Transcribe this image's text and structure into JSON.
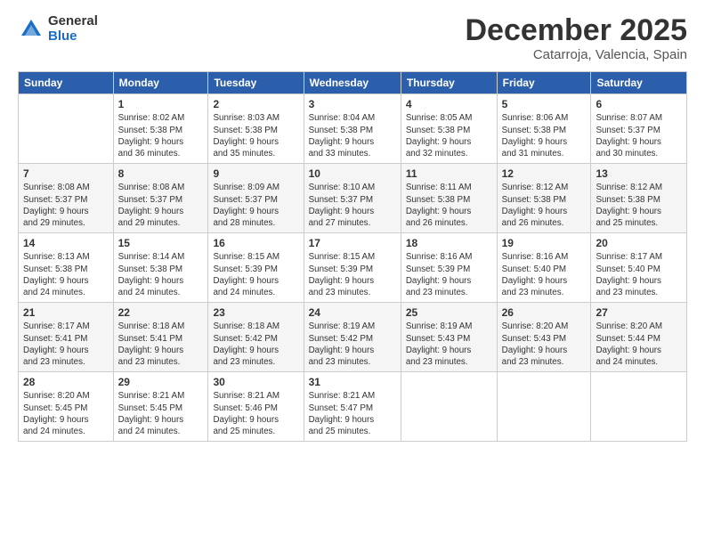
{
  "logo": {
    "general": "General",
    "blue": "Blue"
  },
  "title": "December 2025",
  "location": "Catarroja, Valencia, Spain",
  "weekdays": [
    "Sunday",
    "Monday",
    "Tuesday",
    "Wednesday",
    "Thursday",
    "Friday",
    "Saturday"
  ],
  "weeks": [
    [
      {
        "day": "",
        "info": ""
      },
      {
        "day": "1",
        "info": "Sunrise: 8:02 AM\nSunset: 5:38 PM\nDaylight: 9 hours\nand 36 minutes."
      },
      {
        "day": "2",
        "info": "Sunrise: 8:03 AM\nSunset: 5:38 PM\nDaylight: 9 hours\nand 35 minutes."
      },
      {
        "day": "3",
        "info": "Sunrise: 8:04 AM\nSunset: 5:38 PM\nDaylight: 9 hours\nand 33 minutes."
      },
      {
        "day": "4",
        "info": "Sunrise: 8:05 AM\nSunset: 5:38 PM\nDaylight: 9 hours\nand 32 minutes."
      },
      {
        "day": "5",
        "info": "Sunrise: 8:06 AM\nSunset: 5:38 PM\nDaylight: 9 hours\nand 31 minutes."
      },
      {
        "day": "6",
        "info": "Sunrise: 8:07 AM\nSunset: 5:37 PM\nDaylight: 9 hours\nand 30 minutes."
      }
    ],
    [
      {
        "day": "7",
        "info": "Sunrise: 8:08 AM\nSunset: 5:37 PM\nDaylight: 9 hours\nand 29 minutes."
      },
      {
        "day": "8",
        "info": "Sunrise: 8:08 AM\nSunset: 5:37 PM\nDaylight: 9 hours\nand 29 minutes."
      },
      {
        "day": "9",
        "info": "Sunrise: 8:09 AM\nSunset: 5:37 PM\nDaylight: 9 hours\nand 28 minutes."
      },
      {
        "day": "10",
        "info": "Sunrise: 8:10 AM\nSunset: 5:37 PM\nDaylight: 9 hours\nand 27 minutes."
      },
      {
        "day": "11",
        "info": "Sunrise: 8:11 AM\nSunset: 5:38 PM\nDaylight: 9 hours\nand 26 minutes."
      },
      {
        "day": "12",
        "info": "Sunrise: 8:12 AM\nSunset: 5:38 PM\nDaylight: 9 hours\nand 26 minutes."
      },
      {
        "day": "13",
        "info": "Sunrise: 8:12 AM\nSunset: 5:38 PM\nDaylight: 9 hours\nand 25 minutes."
      }
    ],
    [
      {
        "day": "14",
        "info": "Sunrise: 8:13 AM\nSunset: 5:38 PM\nDaylight: 9 hours\nand 24 minutes."
      },
      {
        "day": "15",
        "info": "Sunrise: 8:14 AM\nSunset: 5:38 PM\nDaylight: 9 hours\nand 24 minutes."
      },
      {
        "day": "16",
        "info": "Sunrise: 8:15 AM\nSunset: 5:39 PM\nDaylight: 9 hours\nand 24 minutes."
      },
      {
        "day": "17",
        "info": "Sunrise: 8:15 AM\nSunset: 5:39 PM\nDaylight: 9 hours\nand 23 minutes."
      },
      {
        "day": "18",
        "info": "Sunrise: 8:16 AM\nSunset: 5:39 PM\nDaylight: 9 hours\nand 23 minutes."
      },
      {
        "day": "19",
        "info": "Sunrise: 8:16 AM\nSunset: 5:40 PM\nDaylight: 9 hours\nand 23 minutes."
      },
      {
        "day": "20",
        "info": "Sunrise: 8:17 AM\nSunset: 5:40 PM\nDaylight: 9 hours\nand 23 minutes."
      }
    ],
    [
      {
        "day": "21",
        "info": "Sunrise: 8:17 AM\nSunset: 5:41 PM\nDaylight: 9 hours\nand 23 minutes."
      },
      {
        "day": "22",
        "info": "Sunrise: 8:18 AM\nSunset: 5:41 PM\nDaylight: 9 hours\nand 23 minutes."
      },
      {
        "day": "23",
        "info": "Sunrise: 8:18 AM\nSunset: 5:42 PM\nDaylight: 9 hours\nand 23 minutes."
      },
      {
        "day": "24",
        "info": "Sunrise: 8:19 AM\nSunset: 5:42 PM\nDaylight: 9 hours\nand 23 minutes."
      },
      {
        "day": "25",
        "info": "Sunrise: 8:19 AM\nSunset: 5:43 PM\nDaylight: 9 hours\nand 23 minutes."
      },
      {
        "day": "26",
        "info": "Sunrise: 8:20 AM\nSunset: 5:43 PM\nDaylight: 9 hours\nand 23 minutes."
      },
      {
        "day": "27",
        "info": "Sunrise: 8:20 AM\nSunset: 5:44 PM\nDaylight: 9 hours\nand 24 minutes."
      }
    ],
    [
      {
        "day": "28",
        "info": "Sunrise: 8:20 AM\nSunset: 5:45 PM\nDaylight: 9 hours\nand 24 minutes."
      },
      {
        "day": "29",
        "info": "Sunrise: 8:21 AM\nSunset: 5:45 PM\nDaylight: 9 hours\nand 24 minutes."
      },
      {
        "day": "30",
        "info": "Sunrise: 8:21 AM\nSunset: 5:46 PM\nDaylight: 9 hours\nand 25 minutes."
      },
      {
        "day": "31",
        "info": "Sunrise: 8:21 AM\nSunset: 5:47 PM\nDaylight: 9 hours\nand 25 minutes."
      },
      {
        "day": "",
        "info": ""
      },
      {
        "day": "",
        "info": ""
      },
      {
        "day": "",
        "info": ""
      }
    ]
  ]
}
